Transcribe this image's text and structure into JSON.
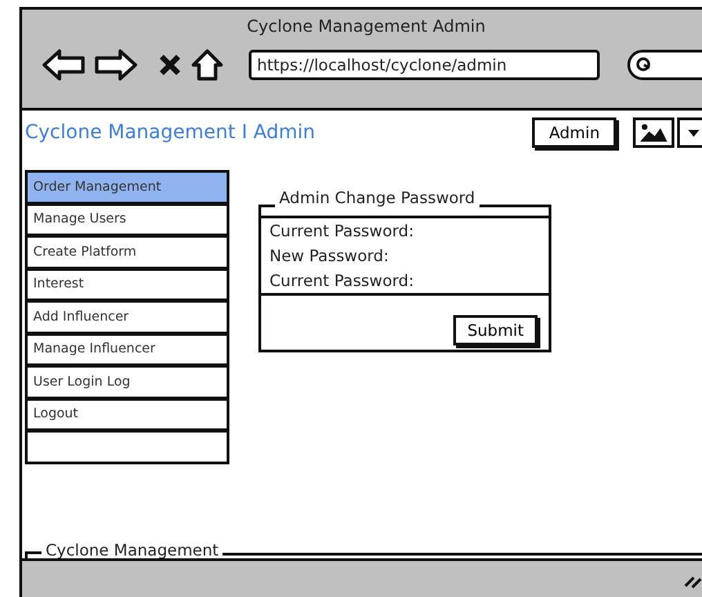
{
  "window": {
    "title": "Cyclone Management Admin"
  },
  "browser": {
    "url": "https://localhost/cyclone/admin"
  },
  "header": {
    "title": "Cyclone Management I Admin",
    "user_button": "Admin"
  },
  "sidebar": {
    "items": [
      {
        "label": "Order Management",
        "selected": true
      },
      {
        "label": "Manage Users",
        "selected": false
      },
      {
        "label": "Create Platform",
        "selected": false
      },
      {
        "label": "Interest",
        "selected": false
      },
      {
        "label": "Add Influencer",
        "selected": false
      },
      {
        "label": "Manage Influencer",
        "selected": false
      },
      {
        "label": "User Login Log",
        "selected": false
      },
      {
        "label": "Logout",
        "selected": false
      }
    ]
  },
  "form": {
    "title": "Admin Change Password",
    "fields": [
      "Current Password:",
      "New Password:",
      "Current Password:"
    ],
    "submit": "Submit"
  },
  "footer": {
    "title": "Cyclone Management"
  }
}
